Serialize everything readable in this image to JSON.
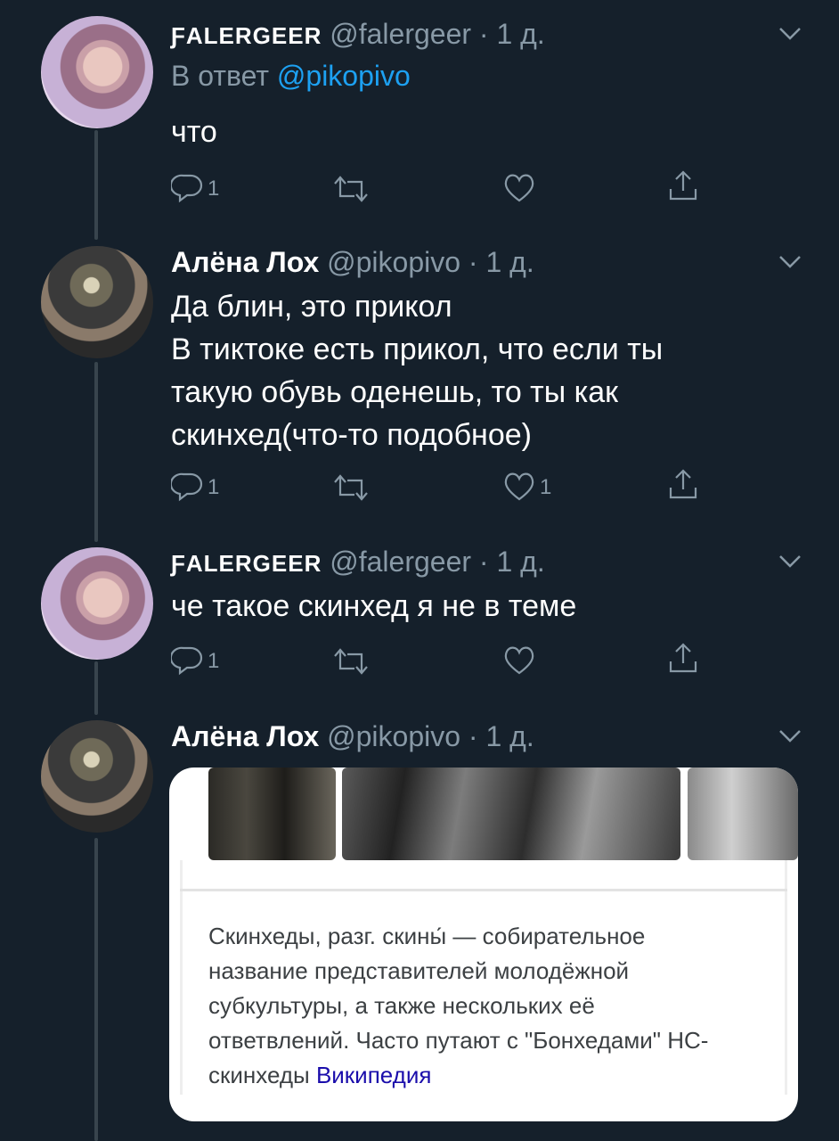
{
  "tweets": [
    {
      "name": "ƑALERGEER",
      "handle": "@falergeer",
      "time": "· 1 д.",
      "reply_prefix": "В ответ ",
      "reply_user": "@pikopivo",
      "text": "что",
      "replies": "1",
      "likes": ""
    },
    {
      "name": "Алёна Лох",
      "handle": "@pikopivo",
      "time": "· 1 д.",
      "lines": [
        "Да блин, это прикол",
        "В тиктоке есть прикол, что если ты",
        "такую обувь оденешь, то ты как",
        "скинхед(что-то подобное)"
      ],
      "replies": "1",
      "likes": "1"
    },
    {
      "name": "ƑALERGEER",
      "handle": "@falergeer",
      "time": "· 1 д.",
      "text": "че такое скинхед я не в теме",
      "replies": "1",
      "likes": ""
    },
    {
      "name": "Алёна Лох",
      "handle": "@pikopivo",
      "time": "· 1 д.",
      "card": {
        "lines": [
          "Скинхеды, разг. скины́ — собирательное",
          "название представителей молодёжной",
          "субкультуры, а также нескольких её",
          "ответвлений. Часто путают с \"Бонхедами\" НС-",
          "скинхеды "
        ],
        "source": "Википедия"
      }
    }
  ],
  "icons": [
    "reply-icon",
    "retweet-icon",
    "like-icon",
    "share-icon",
    "chevron-down-icon"
  ],
  "colors": {
    "background": "#15202b",
    "secondary_text": "#8899a6",
    "link": "#1da1f2"
  }
}
